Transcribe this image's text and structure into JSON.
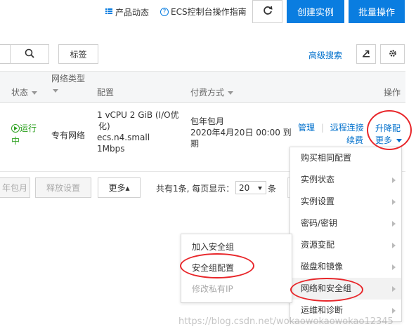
{
  "header": {
    "product_news": "产品动态",
    "ecs_guide": "ECS控制台操作指南",
    "create_instance": "创建实例",
    "batch_ops": "批量操作"
  },
  "toolbar": {
    "tag_label": "标签",
    "advanced_search": "高级搜索"
  },
  "table": {
    "col_status": "状态",
    "col_network_type": "网络类型",
    "col_config": "配置",
    "col_billing": "付费方式",
    "col_actions": "操作",
    "row": {
      "status_1": "运行",
      "status_2": "中",
      "network": "专有网络",
      "config_1": "1 vCPU 2 GiB (I/O优",
      "config_2": "化)",
      "config_3": "ecs.n4.small",
      "config_4": "1Mbps",
      "billing_1": "包年包月",
      "billing_2": "2020年4月20日 00:00 到",
      "billing_3": "期",
      "manage": "管理",
      "remote_connect": "远程连接",
      "upgrade": "升降配",
      "renew": "续费",
      "more": "更多"
    }
  },
  "footer": {
    "btn_yearly": "年包月",
    "btn_release": "释放设置",
    "btn_more": "更多▴",
    "pagination_text": "共有1条, 每页显示：",
    "page_size": "20",
    "unit": "条"
  },
  "more_menu": [
    {
      "label": "购买相同配置",
      "has_sub": false
    },
    {
      "label": "实例状态",
      "has_sub": true
    },
    {
      "label": "实例设置",
      "has_sub": true
    },
    {
      "label": "密码/密钥",
      "has_sub": true
    },
    {
      "label": "资源变配",
      "has_sub": true
    },
    {
      "label": "磁盘和镜像",
      "has_sub": true
    },
    {
      "label": "网络和安全组",
      "has_sub": true
    },
    {
      "label": "运维和诊断",
      "has_sub": true
    }
  ],
  "sub_menu": [
    {
      "label": "加入安全组"
    },
    {
      "label": "安全组配置"
    },
    {
      "label": "修改私有IP"
    }
  ],
  "watermark": "https://blog.csdn.net/wokaowokaowokao12345",
  "colors": {
    "accent": "#0a7de0",
    "link": "#0070cc",
    "running": "#2ea121",
    "highlight_circle": "#e8262a"
  }
}
